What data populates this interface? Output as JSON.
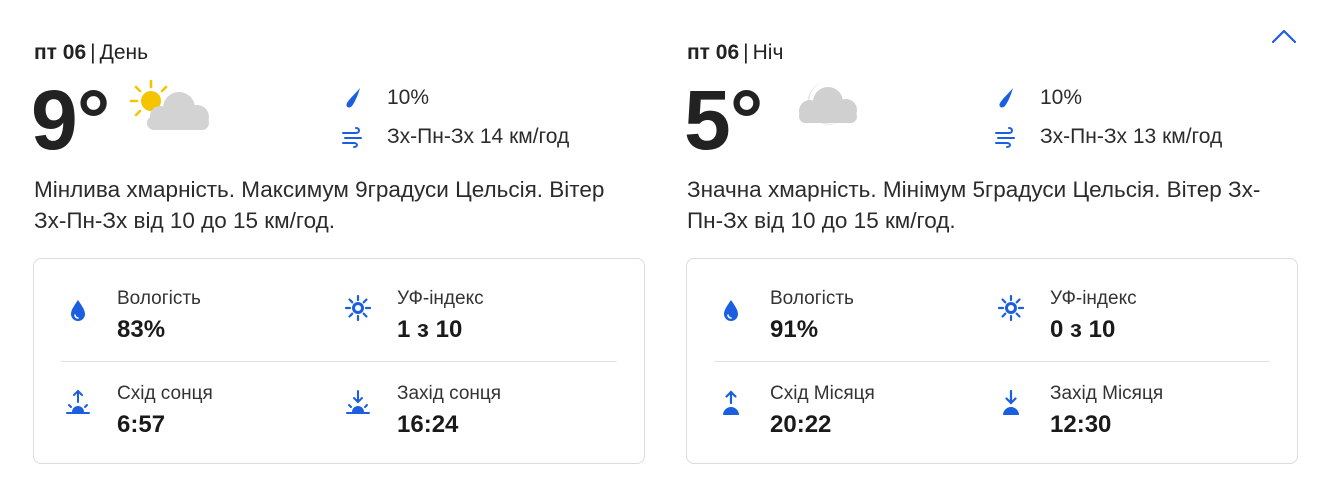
{
  "colors": {
    "accent": "#1b5fe0",
    "border": "#dcdcdc",
    "text": "#222222",
    "sun": "#f5c400",
    "cloud": "#d0d0d0"
  },
  "collapse_button": {
    "icon": "chevron-up-icon"
  },
  "day": {
    "date": "пт 06",
    "separator": "|",
    "period": "День",
    "temperature": "9°",
    "condition_icon": "partly-cloudy-day-icon",
    "precipitation": "10%",
    "wind": "Зх-Пн-Зх 14 км/год",
    "summary": "Мінлива хмарність. Максимум 9градуси Цельсія. Вітер Зх-Пн-Зх від 10 до 15 км/год.",
    "details": {
      "humidity": {
        "label": "Вологість",
        "value": "83%",
        "icon": "humidity-drop-icon"
      },
      "uv": {
        "label": "УФ-індекс",
        "value": "1 з 10",
        "icon": "uv-sun-icon"
      },
      "rise": {
        "label": "Схід сонця",
        "value": "6:57",
        "icon": "sunrise-icon"
      },
      "set": {
        "label": "Захід сонця",
        "value": "16:24",
        "icon": "sunset-icon"
      }
    }
  },
  "night": {
    "date": "пт 06",
    "separator": "|",
    "period": "Ніч",
    "temperature": "5°",
    "condition_icon": "cloudy-night-icon",
    "precipitation": "10%",
    "wind": "Зх-Пн-Зх 13 км/год",
    "summary": "Значна хмарність. Мінімум 5градуси Цельсія. Вітер Зх-Пн-Зх від 10 до 15 км/год.",
    "details": {
      "humidity": {
        "label": "Вологість",
        "value": "91%",
        "icon": "humidity-drop-icon"
      },
      "uv": {
        "label": "УФ-індекс",
        "value": "0 з 10",
        "icon": "uv-sun-icon"
      },
      "rise": {
        "label": "Схід Місяця",
        "value": "20:22",
        "icon": "moonrise-icon"
      },
      "set": {
        "label": "Захід Місяця",
        "value": "12:30",
        "icon": "moonset-icon"
      }
    }
  }
}
